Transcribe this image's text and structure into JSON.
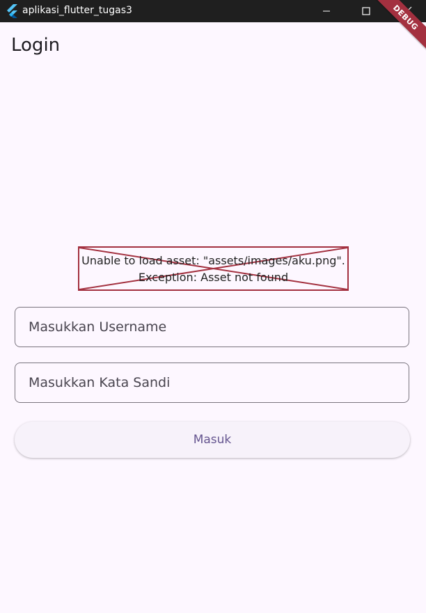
{
  "window": {
    "title": "aplikasi_flutter_tugas3"
  },
  "appbar": {
    "title": "Login"
  },
  "debug_banner": {
    "label": "DEBUG"
  },
  "image_error": {
    "line1": "Unable to load asset: \"assets/images/aku.png\".",
    "line2": "Exception: Asset not found"
  },
  "form": {
    "username_placeholder": "Masukkan Username",
    "password_placeholder": "Masukkan Kata Sandi",
    "submit_label": "Masuk"
  },
  "colors": {
    "background": "#fdf7ff",
    "titlebar": "#1f1f1f",
    "error": "#a3303f",
    "button_text": "#65558f"
  },
  "icons": {
    "app": "flutter-logo-icon",
    "minimize": "minimize-icon",
    "maximize": "maximize-icon",
    "close": "close-icon"
  }
}
